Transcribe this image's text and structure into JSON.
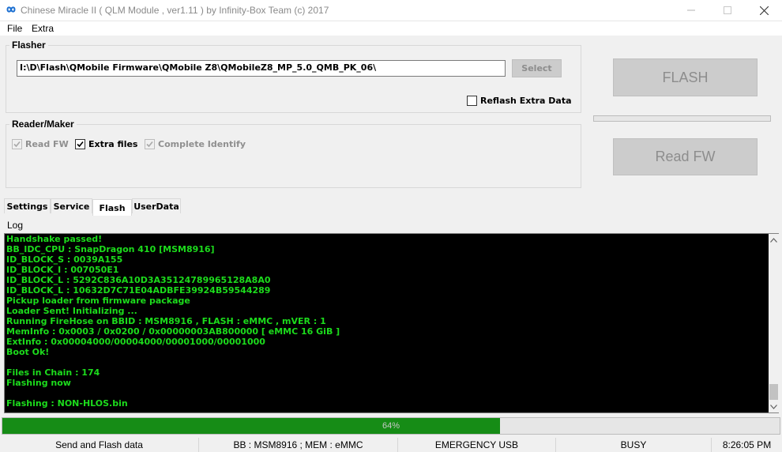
{
  "window": {
    "title": "Chinese Miracle II ( QLM Module , ver1.11  ) by Infinity-Box Team (c) 2017",
    "icon": "infinity-icon",
    "controls": [
      "minimize-icon",
      "maximize-icon",
      "close-icon"
    ]
  },
  "menu": {
    "items": [
      "File",
      "Extra"
    ]
  },
  "flasher": {
    "title": "Flasher",
    "path_value": "I:\\D\\Flash\\QMobile Firmware\\QMobile Z8\\QMobileZ8_MP_5.0_QMB_PK_06\\",
    "select_label": "Select",
    "reflash_label": "Reflash Extra Data",
    "reflash_checked": false
  },
  "reader": {
    "title": "Reader/Maker",
    "read_fw_label": "Read FW",
    "read_fw_checked": true,
    "extra_files_label": "Extra files",
    "extra_files_checked": true,
    "complete_identify_label": "Complete Identify",
    "complete_identify_checked": true
  },
  "actions": {
    "flash_label": "FLASH",
    "read_fw_label": "Read FW"
  },
  "tabs": [
    {
      "label": "Settings",
      "active": false
    },
    {
      "label": "Service",
      "active": false
    },
    {
      "label": "Flash",
      "active": true
    },
    {
      "label": "UserData",
      "active": false
    }
  ],
  "log": {
    "label": "Log",
    "text_color": "#1cdc1c",
    "lines": [
      "Handshake passed!",
      "BB_IDC_CPU : SnapDragon 410 [MSM8916]",
      "ID_BLOCK_S : 0039A155",
      "ID_BLOCK_I : 007050E1",
      "ID_BLOCK_L : 5292C836A10D3A35124789965128A8A0",
      "ID_BLOCK_L : 10632D7C71E04ADBFE39924B59544289",
      "Pickup loader from firmware package",
      "Loader Sent! Initializing ...",
      "Running FireHose on BBID : MSM8916 , FLASH : eMMC , mVER : 1",
      "MemInfo : 0x0003 / 0x0200 / 0x00000003AB800000 [ eMMC 16 GiB ]",
      "ExtInfo : 0x00004000/00004000/00001000/00001000",
      "Boot Ok!",
      "",
      "Files in Chain : 174",
      "Flashing now",
      "",
      "Flashing : NON-HLOS.bin"
    ]
  },
  "progress": {
    "value": 0.64,
    "label": "64%",
    "fill_color": "#168c16"
  },
  "status": {
    "action": "Send and Flash data",
    "bb_info": "BB : MSM8916 ; MEM : eMMC",
    "mode": "EMERGENCY USB",
    "state": "BUSY",
    "time": "8:26:05 PM"
  }
}
